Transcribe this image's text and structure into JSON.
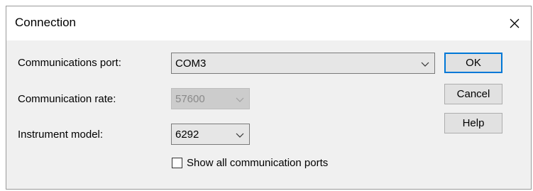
{
  "window": {
    "title": "Connection",
    "close_glyph": "✕"
  },
  "fields": {
    "port_label": "Communications port:",
    "port_value": "COM3",
    "rate_label": "Communication rate:",
    "rate_value": "57600",
    "model_label": "Instrument model:",
    "model_value": "6292"
  },
  "options": {
    "show_all_label": "Show all communication ports",
    "show_all_checked": false
  },
  "buttons": {
    "ok": "OK",
    "cancel": "Cancel",
    "help": "Help"
  },
  "colors": {
    "default_button_border": "#0078d7",
    "dialog_bg": "#f0f0f0"
  },
  "icons": {
    "dropdown": "chevron-down-icon",
    "close": "close-icon"
  }
}
